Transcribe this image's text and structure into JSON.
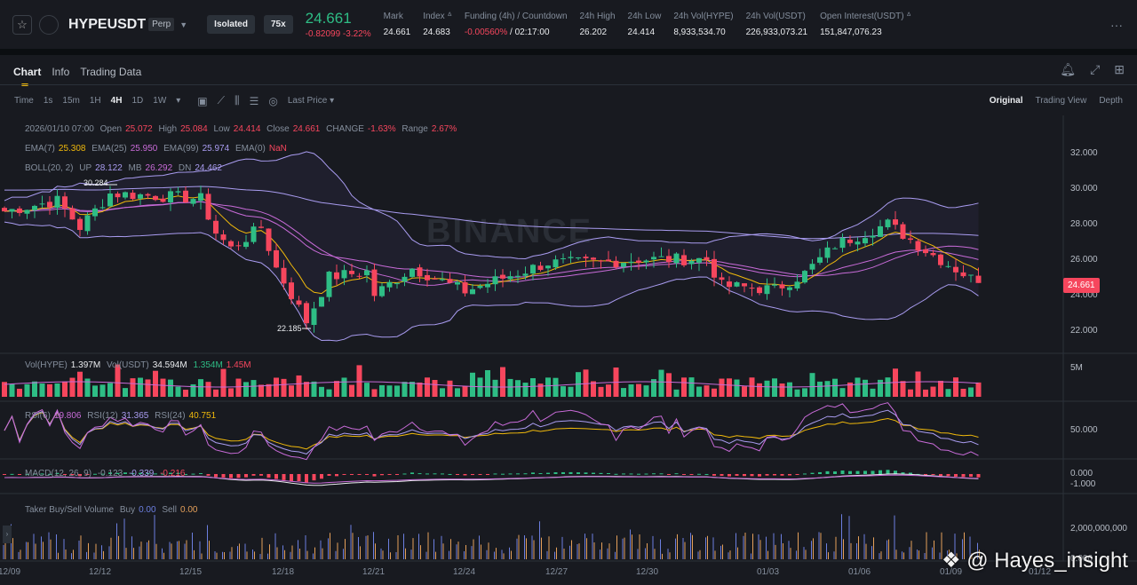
{
  "header": {
    "symbol": "HYPEUSDT",
    "type": "Perp",
    "margin": "Isolated",
    "leverage": "75x",
    "last": "24.661",
    "change": "-0.82099",
    "change_pct": "-3.22%",
    "stats": [
      {
        "label": "Mark",
        "value": "24.661"
      },
      {
        "label": "Index ᐞ",
        "value": "24.683"
      },
      {
        "label": "Funding (4h) / Countdown",
        "value": "-0.00560%",
        "value2": " / 02:17:00"
      },
      {
        "label": "24h High",
        "value": "26.202"
      },
      {
        "label": "24h Low",
        "value": "24.414"
      },
      {
        "label": "24h Vol(HYPE)",
        "value": "8,933,534.70"
      },
      {
        "label": "24h Vol(USDT)",
        "value": "226,933,073.21"
      },
      {
        "label": "Open Interest(USDT) ᐞ",
        "value": "151,847,076.23"
      }
    ],
    "more": "···"
  },
  "tabs": [
    "Chart",
    "Info",
    "Trading Data"
  ],
  "toolbar": {
    "intervals": [
      "Time",
      "1s",
      "15m",
      "1H",
      "4H",
      "1D",
      "1W"
    ],
    "active": "4H",
    "price_type": "Last Price",
    "views": [
      "Original",
      "Trading View",
      "Depth"
    ]
  },
  "ohlc": {
    "date": "2026/01/10 07:00",
    "open_l": "Open",
    "open": "25.072",
    "high_l": "High",
    "high": "25.084",
    "low_l": "Low",
    "low": "24.414",
    "close_l": "Close",
    "close": "24.661",
    "change_l": "CHANGE",
    "change": "-1.63%",
    "range_l": "Range",
    "range": "2.67%"
  },
  "ema": {
    "l7": "EMA(7)",
    "v7": "25.308",
    "l25": "EMA(25)",
    "v25": "25.950",
    "l99": "EMA(99)",
    "v99": "25.974",
    "l0": "EMA(0)",
    "v0": "NaN"
  },
  "boll": {
    "l": "BOLL(20, 2)",
    "up_l": "UP",
    "up": "28.122",
    "mb_l": "MB",
    "mb": "26.292",
    "dn_l": "DN",
    "dn": "24.462"
  },
  "price_axis": [
    "32.000",
    "30.000",
    "28.000",
    "26.000",
    "24.000",
    "22.000"
  ],
  "current_price_tag": "24.661",
  "high_mark": "30.284",
  "low_mark": "22.185",
  "vol": {
    "l1": "Vol(HYPE)",
    "v1": "1.397M",
    "l2": "Vol(USDT)",
    "v2": "34.594M",
    "v3": "1.354M",
    "v4": "1.45M",
    "axis": "5M"
  },
  "rsi": {
    "l6": "RSI(6)",
    "v6": "19.806",
    "l12": "RSI(12)",
    "v12": "31.365",
    "l24": "RSI(24)",
    "v24": "40.751",
    "axis": "50.000"
  },
  "macd": {
    "l": "MACD(12, 26, 9)",
    "dif": "-0.123",
    "dea": "-0.339",
    "hist": "-0.216",
    "axis1": "0.000",
    "axis2": "-1.000"
  },
  "taker": {
    "l": "Taker Buy/Sell Volume",
    "buy_l": "Buy",
    "buy": "0.00",
    "sell_l": "Sell",
    "sell": "0.00",
    "axis1": "2,000,000,000",
    "axis2": "0.000"
  },
  "dates": [
    "12/09",
    "12/12",
    "12/15",
    "12/18",
    "12/21",
    "12/24",
    "12/27",
    "12/30",
    "01/03",
    "01/06",
    "01/09",
    "01/12"
  ],
  "watermark": "@ Hayes_insight",
  "brand_watermark": "BINANCE",
  "price_path": [
    [
      0,
      28.7
    ],
    [
      7,
      29.3
    ],
    [
      10,
      27.8
    ],
    [
      14,
      29.7
    ],
    [
      23,
      29.5
    ],
    [
      26,
      29.4
    ],
    [
      28,
      27.5
    ],
    [
      30,
      26.6
    ],
    [
      34,
      27.8
    ],
    [
      36,
      25.5
    ],
    [
      40,
      22.5
    ],
    [
      43,
      25.0
    ],
    [
      48,
      25.3
    ],
    [
      49,
      24.0
    ],
    [
      54,
      25.5
    ],
    [
      61,
      24.2
    ],
    [
      65,
      24.8
    ],
    [
      72,
      25.8
    ],
    [
      79,
      25.8
    ],
    [
      84,
      26.0
    ],
    [
      93,
      26.0
    ],
    [
      95,
      24.5
    ],
    [
      102,
      24.3
    ],
    [
      106,
      25.2
    ],
    [
      110,
      26.8
    ],
    [
      117,
      28.0
    ],
    [
      122,
      26.5
    ],
    [
      129,
      24.66
    ]
  ],
  "colors": {
    "up": "#2ebd85",
    "down": "#f6465d",
    "ema7": "#f0b90b",
    "ema25": "#c86bd8",
    "ema99": "#a99cf0"
  }
}
